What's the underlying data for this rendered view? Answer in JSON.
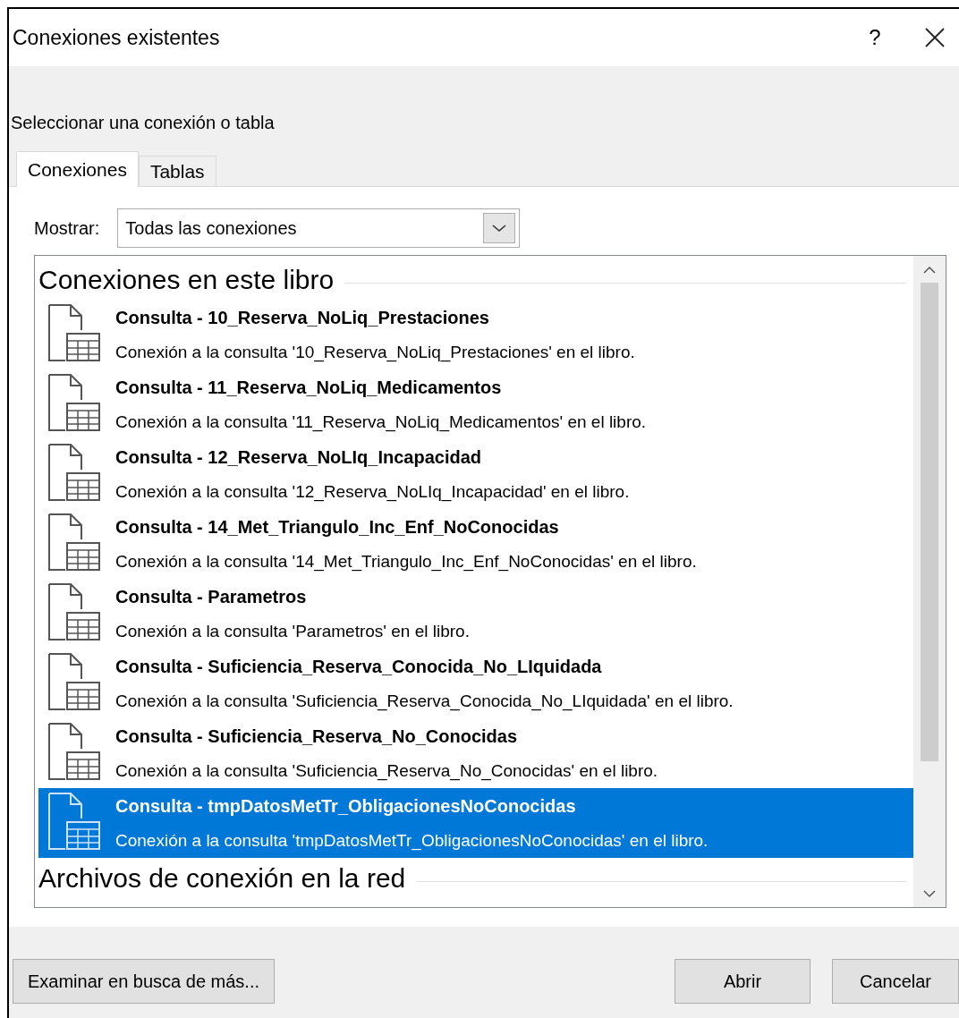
{
  "window": {
    "title": "Conexiones existentes",
    "help": "?"
  },
  "prompt": "Seleccionar una conexión o tabla",
  "tabs": [
    {
      "label": "Conexiones",
      "selected": true
    },
    {
      "label": "Tablas",
      "selected": false
    }
  ],
  "filter": {
    "label": "Mostrar:",
    "value": "Todas las conexiones"
  },
  "groups": [
    {
      "title": "Conexiones en este libro",
      "items": [
        {
          "name": "Consulta - 10_Reserva_NoLiq_Prestaciones",
          "description": "Conexión a la consulta '10_Reserva_NoLiq_Prestaciones' en el libro.",
          "selected": false
        },
        {
          "name": "Consulta - 11_Reserva_NoLiq_Medicamentos",
          "description": "Conexión a la consulta '11_Reserva_NoLiq_Medicamentos' en el libro.",
          "selected": false
        },
        {
          "name": "Consulta - 12_Reserva_NoLIq_Incapacidad",
          "description": "Conexión a la consulta '12_Reserva_NoLIq_Incapacidad' en el libro.",
          "selected": false
        },
        {
          "name": "Consulta - 14_Met_Triangulo_Inc_Enf_NoConocidas",
          "description": "Conexión a la consulta '14_Met_Triangulo_Inc_Enf_NoConocidas' en el libro.",
          "selected": false
        },
        {
          "name": "Consulta - Parametros",
          "description": "Conexión a la consulta 'Parametros' en el libro.",
          "selected": false
        },
        {
          "name": "Consulta - Suficiencia_Reserva_Conocida_No_LIquidada",
          "description": "Conexión a la consulta 'Suficiencia_Reserva_Conocida_No_LIquidada' en el libro.",
          "selected": false
        },
        {
          "name": "Consulta - Suficiencia_Reserva_No_Conocidas",
          "description": "Conexión a la consulta 'Suficiencia_Reserva_No_Conocidas' en el libro.",
          "selected": false
        },
        {
          "name": "Consulta - tmpDatosMetTr_ObligacionesNoConocidas",
          "description": "Conexión a la consulta 'tmpDatosMetTr_ObligacionesNoConocidas' en el libro.",
          "selected": true
        }
      ]
    },
    {
      "title": "Archivos de conexión en la red"
    }
  ],
  "buttons": {
    "browse": "Examinar en busca de más...",
    "open": "Abrir",
    "cancel": "Cancelar"
  }
}
